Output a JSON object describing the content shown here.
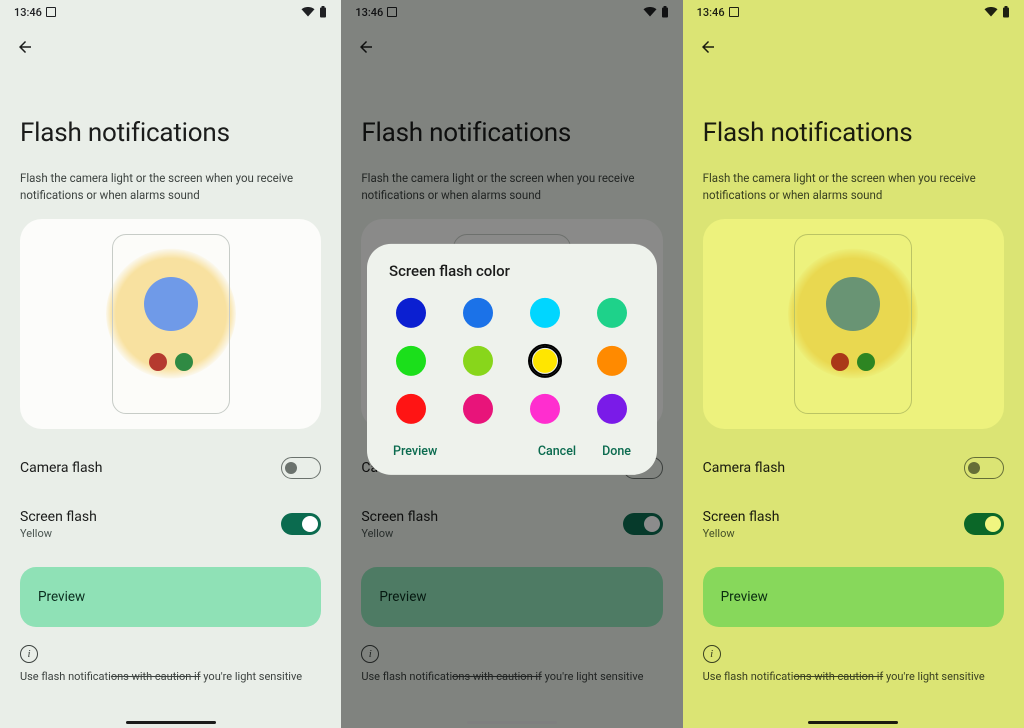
{
  "status": {
    "time": "13:46"
  },
  "page": {
    "title": "Flash notifications",
    "subtitle": "Flash the camera light or the screen when you receive notifications or when alarms sound"
  },
  "settings": {
    "camera_flash_label": "Camera flash",
    "screen_flash_label": "Screen flash",
    "screen_flash_value": "Yellow"
  },
  "actions": {
    "preview_label": "Preview"
  },
  "footnote": {
    "prefix": "Use flash notificati",
    "struck": "ons with caution if",
    "suffix": " you're light sensitive"
  },
  "dialog": {
    "title": "Screen flash color",
    "preview": "Preview",
    "cancel": "Cancel",
    "done": "Done",
    "colors": [
      "#0b1fd1",
      "#1b72e8",
      "#00d6ff",
      "#1ed28a",
      "#1bdf1b",
      "#88d61b",
      "#ffe600",
      "#ff8a00",
      "#ff1414",
      "#e8147a",
      "#ff2ecf",
      "#7a1be8"
    ],
    "selected_index": 6
  }
}
